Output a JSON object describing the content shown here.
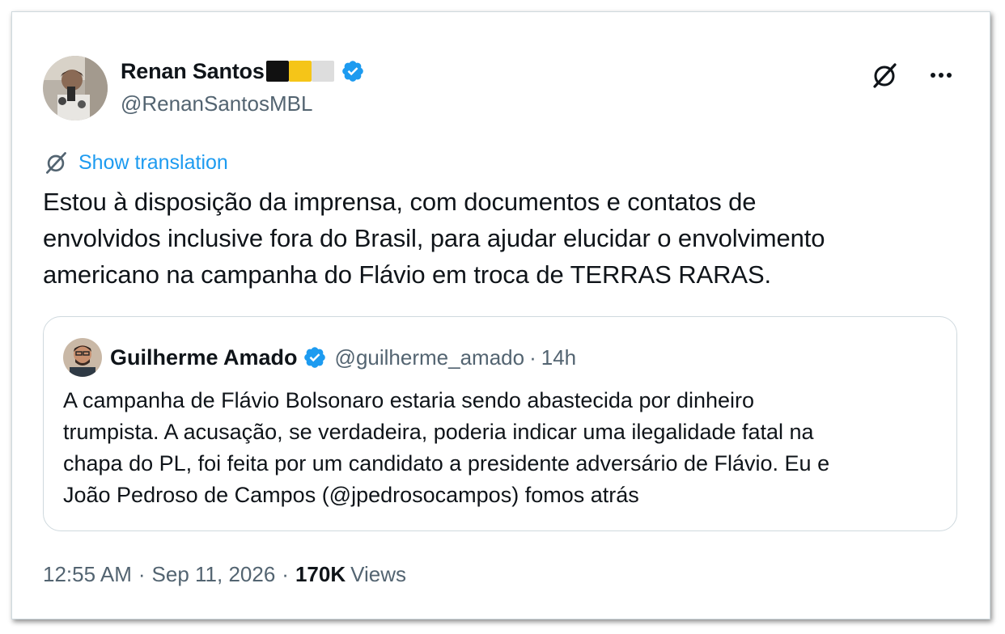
{
  "author": {
    "name": "Renan Santos",
    "handle": "@RenanSantosMBL",
    "flag_colors": [
      "#111111",
      "#f5c518",
      "#dddddd"
    ]
  },
  "actions": {
    "grok_icon": "grok-icon",
    "more_icon": "more-icon"
  },
  "translation": {
    "label": "Show translation"
  },
  "tweet": {
    "text_lines": [
      "Estou à disposição da imprensa, com documentos e contatos de",
      "envolvidos inclusive fora do Brasil, para ajudar elucidar o envolvimento",
      "americano na campanha do Flávio em troca de TERRAS RARAS."
    ]
  },
  "quote": {
    "name": "Guilherme Amado",
    "handle": "@guilherme_amado",
    "dot": "·",
    "time": "14h",
    "text_lines": [
      "A campanha de Flávio Bolsonaro estaria sendo abastecida por dinheiro",
      "trumpista. A acusação, se verdadeira, poderia indicar uma ilegalidade fatal na",
      "chapa do PL, foi feita por um candidato a presidente adversário de Flávio. Eu e",
      "João Pedroso de Campos (@jpedrosocampos) fomos atrás"
    ]
  },
  "meta": {
    "time": "12:55 AM",
    "sep": "·",
    "date": "Sep 11, 2026",
    "views_count": "170K",
    "views_label": "Views"
  },
  "colors": {
    "accent": "#1d9bf0",
    "text": "#0f1419",
    "secondary": "#536471",
    "border": "#cfd9de"
  }
}
